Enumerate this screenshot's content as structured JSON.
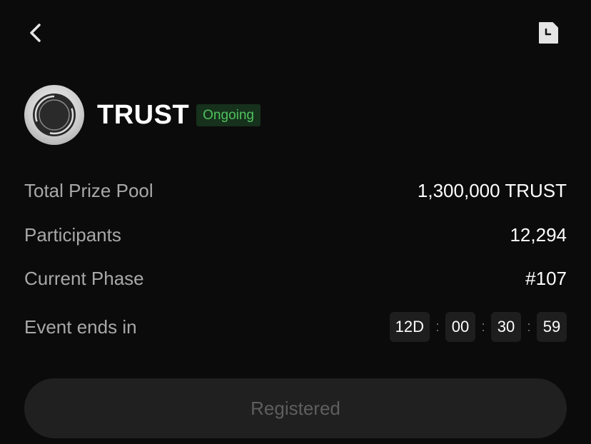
{
  "header": {
    "back_icon": "chevron-left-icon",
    "history_icon": "document-clock-icon"
  },
  "token": {
    "name": "TRUST",
    "status": "Ongoing",
    "status_color": "#4fc25e",
    "logo_icon": "trust-coin-logo"
  },
  "stats": {
    "prize_pool": {
      "label": "Total Prize Pool",
      "value": "1,300,000 TRUST"
    },
    "participants": {
      "label": "Participants",
      "value": "12,294"
    },
    "phase": {
      "label": "Current Phase",
      "value": "#107"
    },
    "ends": {
      "label": "Event ends in"
    }
  },
  "countdown": {
    "days": "12D",
    "hours": "00",
    "minutes": "30",
    "seconds": "59",
    "separator": ":"
  },
  "action": {
    "button_label": "Registered"
  }
}
